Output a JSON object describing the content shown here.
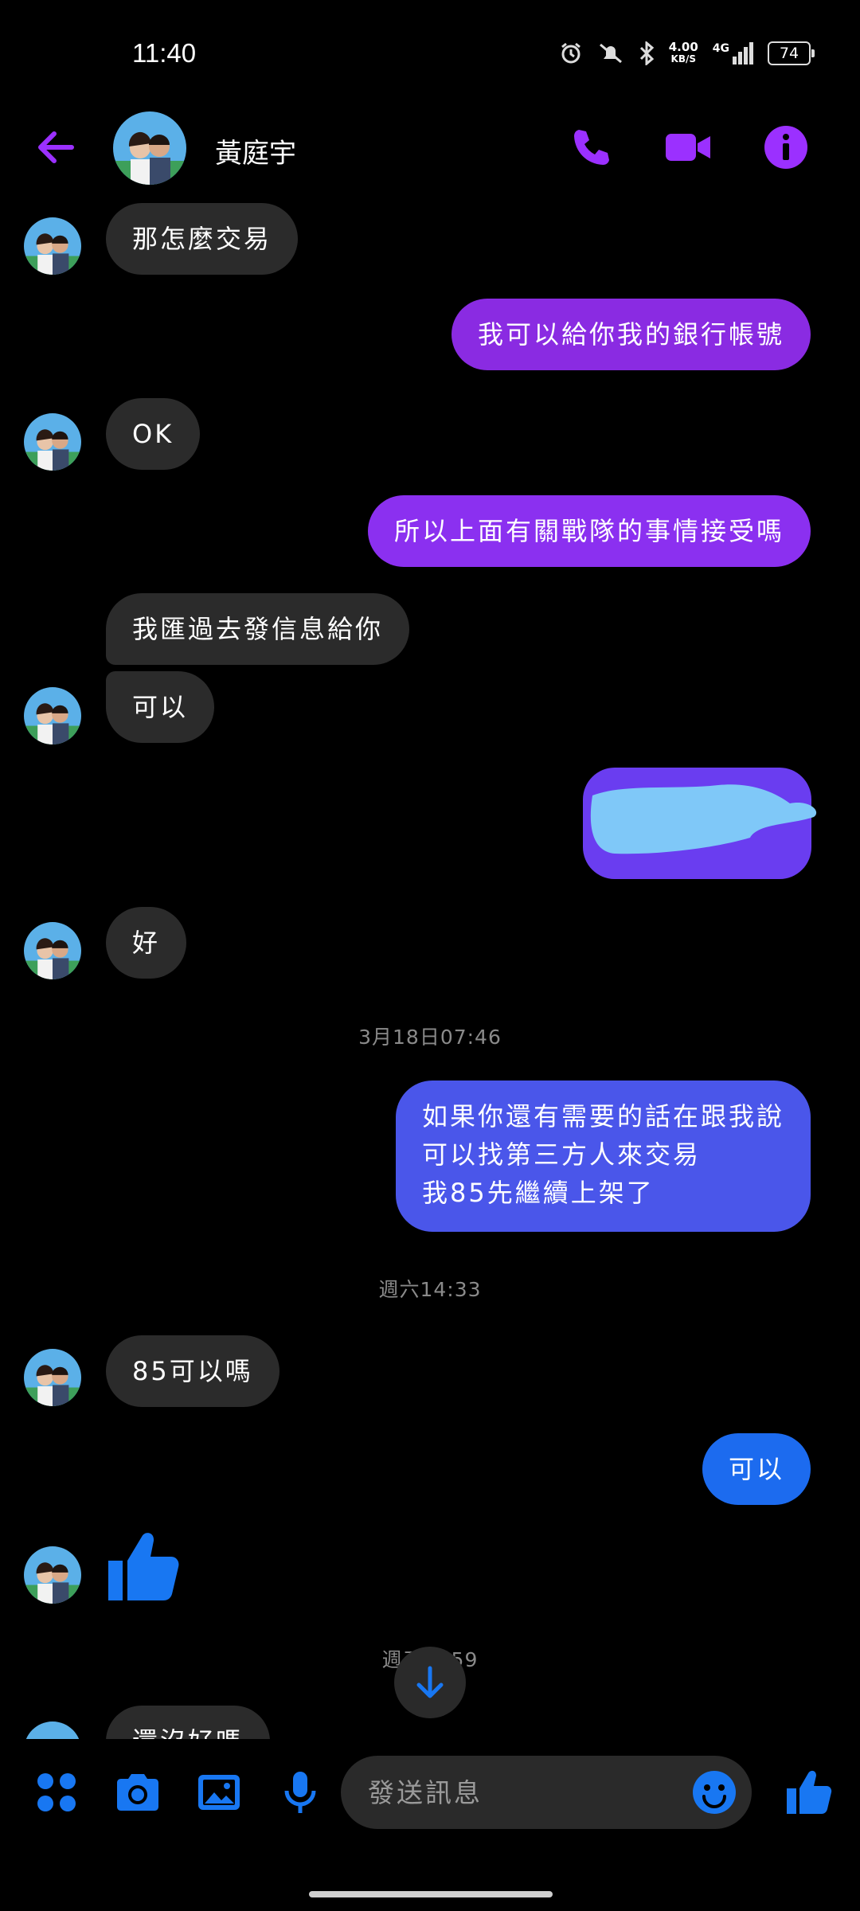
{
  "status_bar": {
    "time": "11:40",
    "net_speed": "4.00",
    "net_unit": "KB/S",
    "network": "4G",
    "battery": "74"
  },
  "header": {
    "contact_name": "黃庭宇"
  },
  "messages": [
    {
      "text": "那怎麼交易"
    },
    {
      "text": "我可以給你我的銀行帳號"
    },
    {
      "text": "OK"
    },
    {
      "text": "所以上面有關戰隊的事情接受嗎"
    },
    {
      "text": "我匯過去發信息給你"
    },
    {
      "text": "可以"
    },
    {
      "text": "好"
    },
    {
      "lines": [
        "如果你還有需要的話在跟我說",
        "可以找第三方人來交易",
        "我85先繼續上架了"
      ]
    },
    {
      "text": "85可以嗎"
    },
    {
      "text": "可以"
    },
    {
      "text": "還沒好嗎"
    }
  ],
  "timestamps": [
    "3月18日07:46",
    "週六14:33",
    "週五 …59"
  ],
  "composer": {
    "placeholder": "發送訊息"
  },
  "colors": {
    "accent_purple": "#9b30ff",
    "accent_blue": "#1877f2",
    "bubble_in": "#2b2b2b"
  }
}
